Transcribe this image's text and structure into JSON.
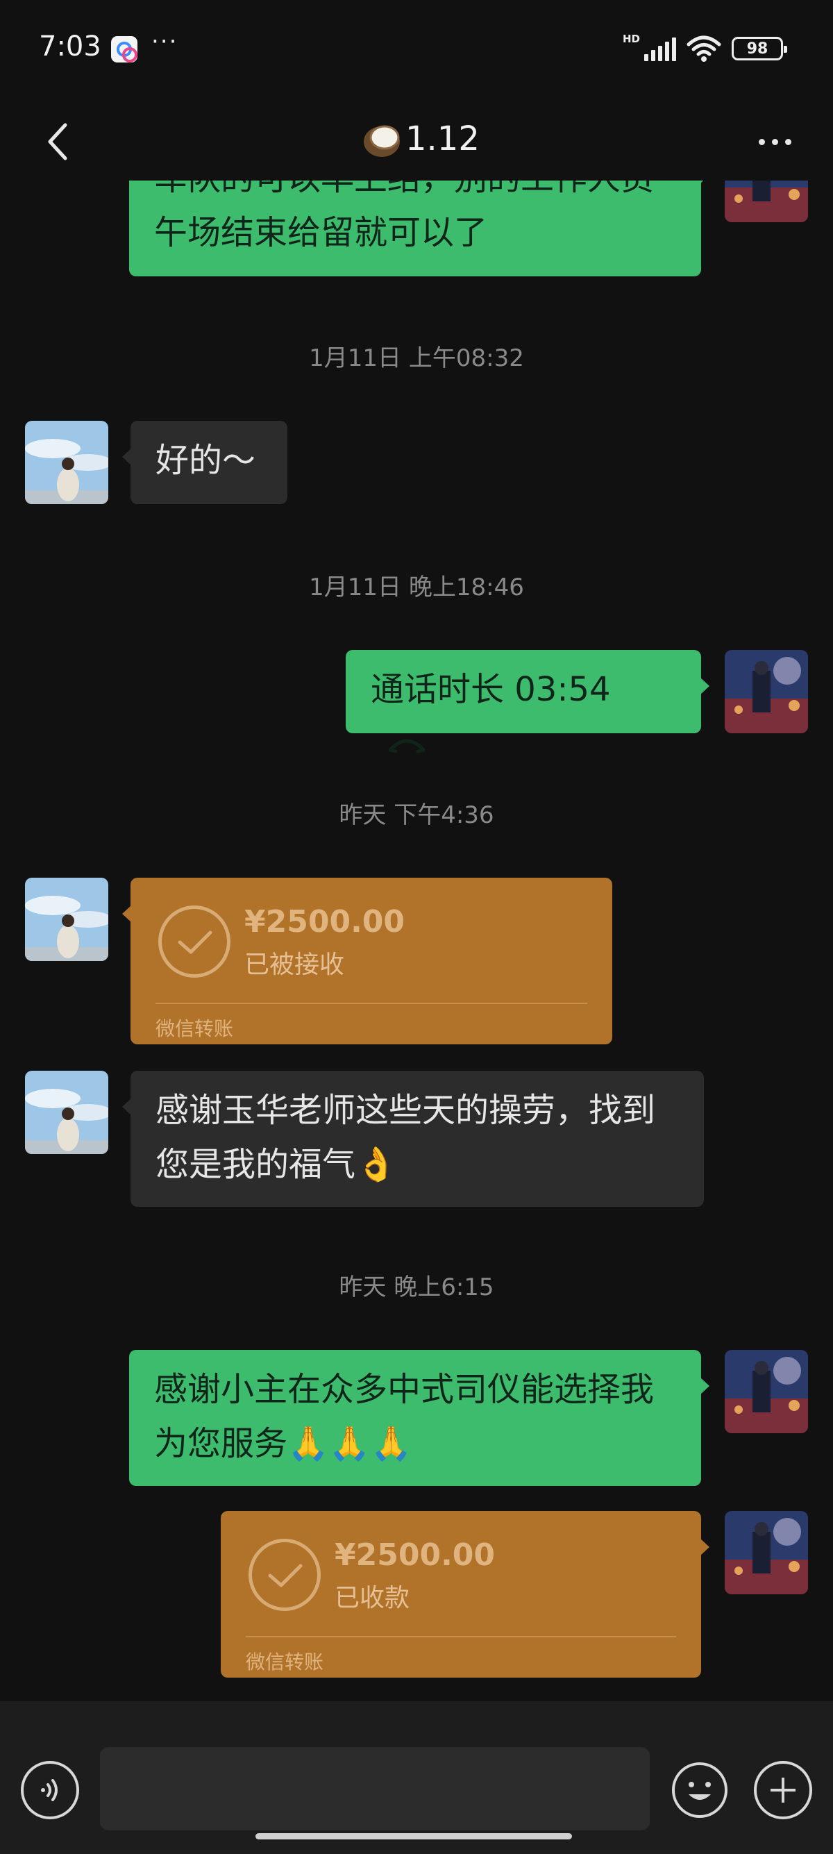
{
  "status_bar": {
    "time": "7:03",
    "more": "···",
    "network": "HD",
    "battery": "98"
  },
  "header": {
    "title": "1.12",
    "title_icon": "coconut-icon",
    "back_icon": "chevron-left-icon",
    "menu_icon": "more-icon"
  },
  "messages": {
    "m1": {
      "line1": "车队的可以早上结，别的工作人员",
      "line2": "午场结束给留就可以了"
    },
    "t1": "1月11日 上午08:32",
    "m2": "好的～",
    "t2": "1月11日 晚上18:46",
    "m3": "通话时长 03:54",
    "t3": "昨天 下午4:36",
    "m4": {
      "amount": "¥2500.00",
      "status": "已被接收",
      "label": "微信转账"
    },
    "m5": {
      "line1": "感谢玉华老师这些天的操劳，找到",
      "line2": "您是我的福气👌"
    },
    "t4": "昨天 晚上6:15",
    "m6": {
      "line1": "感谢小主在众多中式司仪能选择我",
      "line2": "为您服务🙏🙏🙏"
    },
    "m7": {
      "amount": "¥2500.00",
      "status": "已收款",
      "label": "微信转账"
    }
  },
  "input_bar": {
    "placeholder": "",
    "voice_icon": "voice-icon",
    "emoji_icon": "emoji-icon",
    "plus_icon": "plus-icon"
  },
  "colors": {
    "background": "#111111",
    "green_bubble": "#3dbc6e",
    "dark_bubble": "#2c2c2c",
    "transfer": "#b1722a"
  }
}
